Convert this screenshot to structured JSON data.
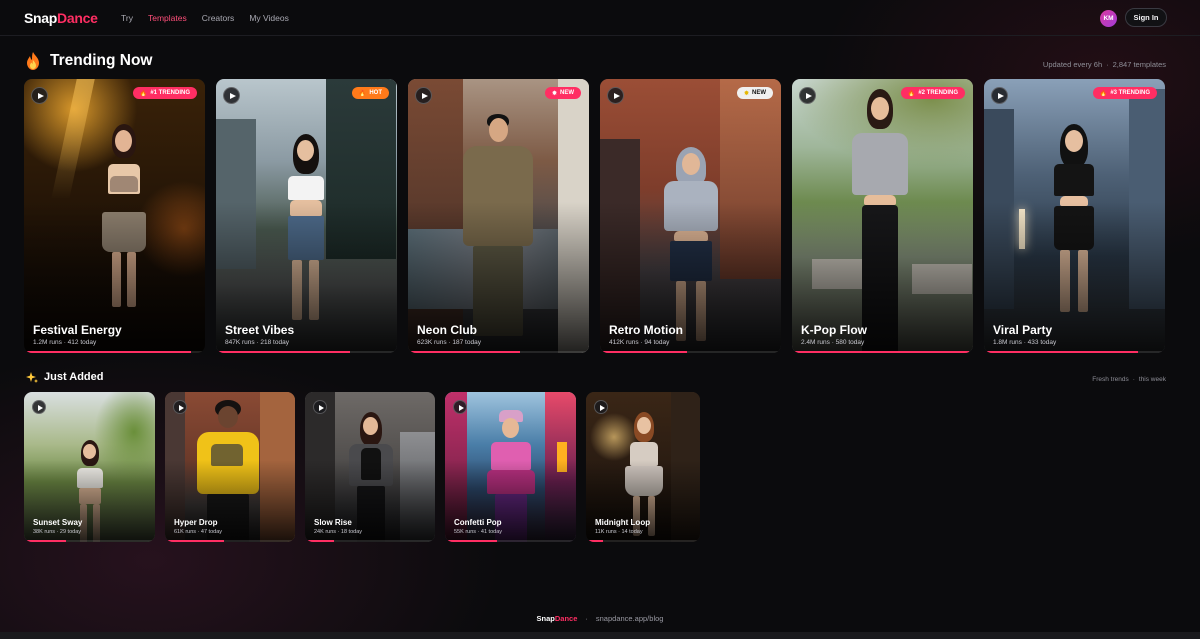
{
  "brand": {
    "part1": "Snap",
    "part2": "Dance"
  },
  "nav": [
    "Try",
    "Templates",
    "Creators",
    "My Videos"
  ],
  "nav_active": "Templates",
  "user": {
    "initials": "KM",
    "signin_label": "Sign In"
  },
  "trending": {
    "icon": "fire-icon",
    "title": "Trending Now",
    "meta_updated": "Updated every 6h",
    "meta_count": "2,847 templates",
    "cards": [
      {
        "name": "Festival Energy",
        "stats": "1.2M runs · 412 today",
        "badge": "#1 TRENDING",
        "badge_type": "trend",
        "progress": 0.92
      },
      {
        "name": "Street Vibes",
        "stats": "847K runs · 218 today",
        "badge": "HOT",
        "badge_type": "hot",
        "progress": 0.74
      },
      {
        "name": "Neon Club",
        "stats": "623K runs · 187 today",
        "badge": "NEW",
        "badge_type": "trend",
        "progress": 0.62
      },
      {
        "name": "Retro Motion",
        "stats": "412K runs · 94 today",
        "badge": "NEW",
        "badge_type": "new",
        "progress": 0.48
      },
      {
        "name": "K-Pop Flow",
        "stats": "2.4M runs · 580 today",
        "badge": "#2 TRENDING",
        "badge_type": "trend",
        "progress": 0.98
      },
      {
        "name": "Viral Party",
        "stats": "1.8M runs · 433 today",
        "badge": "#3 TRENDING",
        "badge_type": "trend",
        "progress": 0.85
      }
    ]
  },
  "just_added": {
    "icon": "sparkles-icon",
    "title": "Just Added",
    "meta_a": "Fresh trends",
    "meta_b": "this week",
    "cards": [
      {
        "name": "Sunset Sway",
        "stats": "38K runs · 29 today",
        "progress": 0.32
      },
      {
        "name": "Hyper Drop",
        "stats": "61K runs · 47 today",
        "progress": 0.45
      },
      {
        "name": "Slow Rise",
        "stats": "24K runs · 18 today",
        "progress": 0.22
      },
      {
        "name": "Confetti Pop",
        "stats": "55K runs · 41 today",
        "progress": 0.4
      },
      {
        "name": "Midnight Loop",
        "stats": "11K runs · 14 today",
        "progress": 0.15
      }
    ]
  },
  "footer": {
    "brand_a": "Snap",
    "brand_b": "Dance",
    "link": "snapdance.app/blog"
  },
  "colors": {
    "accent": "#ff2e63",
    "hot": "#ff7a1a",
    "background": "#0b0b0d"
  }
}
